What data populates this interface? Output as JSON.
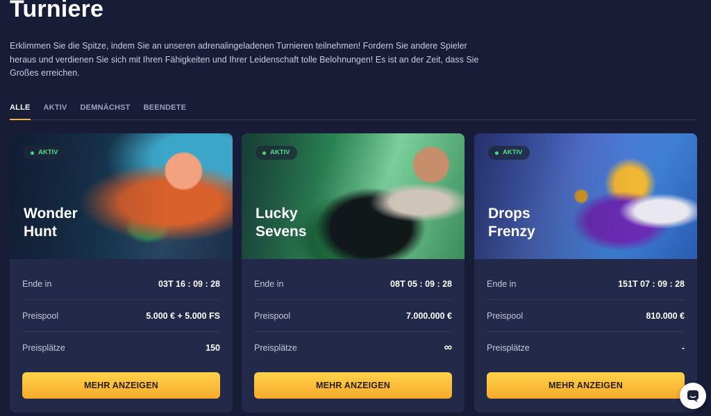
{
  "page": {
    "title": "Turniere",
    "description": "Erklimmen Sie die Spitze, indem Sie an unseren adrenalingeladenen Turnieren teilnehmen! Fordern Sie andere Spieler heraus und verdienen Sie sich mit Ihren Fähigkeiten und Ihrer Leidenschaft tolle Belohnungen! Es ist an der Zeit, dass Sie Großes erreichen."
  },
  "tabs": [
    {
      "label": "ALLE",
      "active": true
    },
    {
      "label": "AKTIV",
      "active": false
    },
    {
      "label": "DEMNÄCHST",
      "active": false
    },
    {
      "label": "BEENDETE",
      "active": false
    }
  ],
  "labels": {
    "ends_in": "Ende in",
    "prize_pool": "Preispool",
    "prize_places": "Preisplätze",
    "more_button": "MEHR ANZEIGEN"
  },
  "tournaments": [
    {
      "status": "AKTIV",
      "name_line1": "Wonder",
      "name_line2": "Hunt",
      "ends_in": "03T  16 : 09 : 28",
      "prize_pool": "5.000 € + 5.000 FS",
      "prize_places": "150"
    },
    {
      "status": "AKTIV",
      "name_line1": "Lucky",
      "name_line2": "Sevens",
      "ends_in": "08T  05 : 09 : 28",
      "prize_pool": "7.000.000 €",
      "prize_places": "∞"
    },
    {
      "status": "AKTIV",
      "name_line1": "Drops",
      "name_line2": "Frenzy",
      "ends_in": "151T  07 : 09 : 28",
      "prize_pool": "810.000 €",
      "prize_places": "-"
    }
  ],
  "colors": {
    "background": "#171c37",
    "card": "#222949",
    "accent": "#f7b52a",
    "status_active": "#4fe08e"
  },
  "icons": {
    "chat": "chat-bubble-icon",
    "status_dot": "status-dot-icon"
  }
}
